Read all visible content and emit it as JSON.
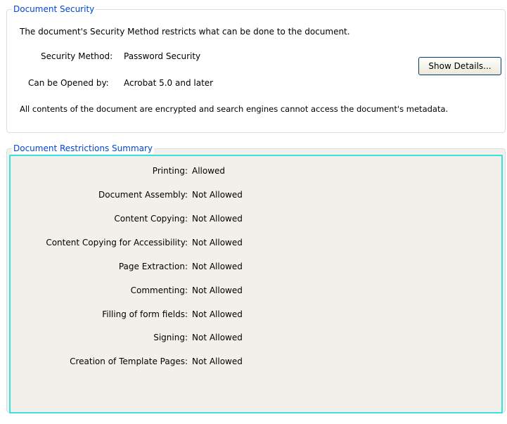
{
  "document_security": {
    "title": "Document Security",
    "description": "The document's Security Method restricts what can be done to the document.",
    "security_method_label": "Security Method:",
    "security_method_value": "Password Security",
    "show_details_label": "Show Details...",
    "opened_by_label": "Can be Opened by:",
    "opened_by_value": "Acrobat 5.0 and later",
    "encryption_note": "All contents of the document are encrypted and search engines cannot access the document's metadata."
  },
  "restrictions": {
    "title": "Document Restrictions Summary",
    "rows": [
      {
        "label": "Printing:",
        "value": "Allowed"
      },
      {
        "label": "Document Assembly:",
        "value": "Not Allowed"
      },
      {
        "label": "Content Copying:",
        "value": "Not Allowed"
      },
      {
        "label": "Content Copying for Accessibility:",
        "value": "Not Allowed"
      },
      {
        "label": "Page Extraction:",
        "value": "Not Allowed"
      },
      {
        "label": "Commenting:",
        "value": "Not Allowed"
      },
      {
        "label": "Filling of form fields:",
        "value": "Not Allowed"
      },
      {
        "label": "Signing:",
        "value": "Not Allowed"
      },
      {
        "label": "Creation of Template Pages:",
        "value": "Not Allowed"
      }
    ]
  },
  "colors": {
    "group_title": "#0046d5",
    "group_border": "#d5dfe5",
    "panel_background": "#f1f0eb",
    "selection_highlight": "#3fe0e0"
  }
}
